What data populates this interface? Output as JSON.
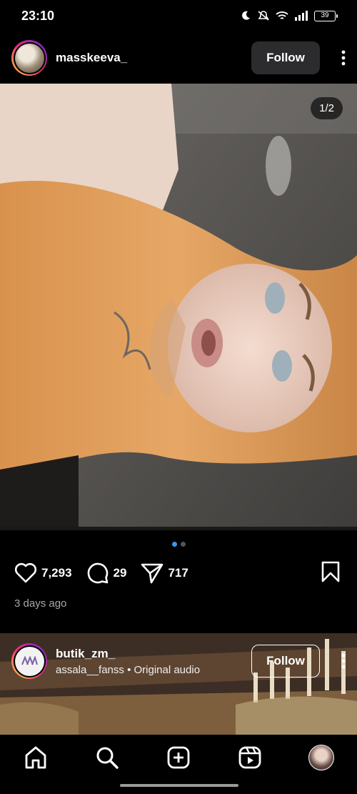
{
  "status_bar": {
    "time": "23:10",
    "battery": "39"
  },
  "post": {
    "username": "masskeeva_",
    "follow_label": "Follow",
    "page_counter": "1/2",
    "carousel": {
      "total": 2,
      "active": 1
    },
    "likes": "7,293",
    "comments": "29",
    "shares": "717",
    "timestamp": "3 days ago"
  },
  "reel": {
    "username": "butik_zm_",
    "audio": "assala__fanss • Original audio",
    "follow_label": "Follow"
  },
  "nav": {
    "items": [
      "home-icon",
      "search-icon",
      "create-icon",
      "reels-icon",
      "profile-avatar"
    ]
  }
}
